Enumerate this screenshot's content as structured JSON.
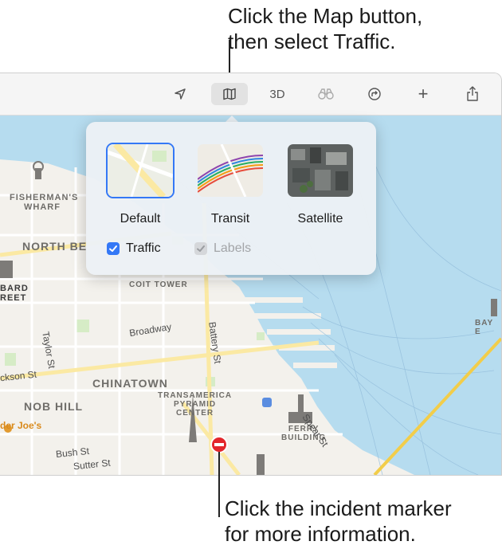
{
  "callouts": {
    "top_line1": "Click the Map button,",
    "top_line2": "then select Traffic.",
    "bottom_line1": "Click the incident marker",
    "bottom_line2": "for more information."
  },
  "toolbar": {
    "location_icon": "location-arrow-icon",
    "map_icon": "map-icon",
    "view_3d_label": "3D",
    "lookaround_icon": "binoculars-icon",
    "directions_icon": "directions-icon",
    "add_label": "+",
    "share_icon": "share-icon"
  },
  "popover": {
    "map_types": [
      {
        "label": "Default",
        "selected": true
      },
      {
        "label": "Transit",
        "selected": false
      },
      {
        "label": "Satellite",
        "selected": false
      }
    ],
    "traffic": {
      "label": "Traffic",
      "checked": true,
      "enabled": true
    },
    "labels": {
      "label": "Labels",
      "checked": true,
      "enabled": false
    }
  },
  "map": {
    "places": {
      "fishermans_wharf_1": "FISHERMAN'S",
      "fishermans_wharf_2": "WHARF",
      "north_beach": "NORTH BE",
      "coit_tower": "COIT TOWER",
      "lombard_1": "BARD",
      "lombard_2": "REET",
      "chinatown": "CHINATOWN",
      "transamerica_1": "TRANSAMERICA",
      "transamerica_2": "PYRAMID",
      "transamerica_3": "CENTER",
      "ferry_1": "FERRY",
      "ferry_2": "BUILDING",
      "nob_hill": "NOB HILL",
      "bay_bridge": "BAY E",
      "traders_joes": "der Joe's"
    },
    "streets": {
      "taylor": "Taylor St",
      "broadway": "Broadway",
      "battery": "Battery St",
      "jackson": "ckson St",
      "spear": "Spear St",
      "bush": "Bush St",
      "sutter": "Sutter St"
    },
    "colors": {
      "water": "#b6dcef",
      "land": "#f3f1ec",
      "park": "#d6ecc6",
      "road": "#fbf0bf",
      "accent": "#3478f6",
      "incident": "#e3262b"
    }
  }
}
